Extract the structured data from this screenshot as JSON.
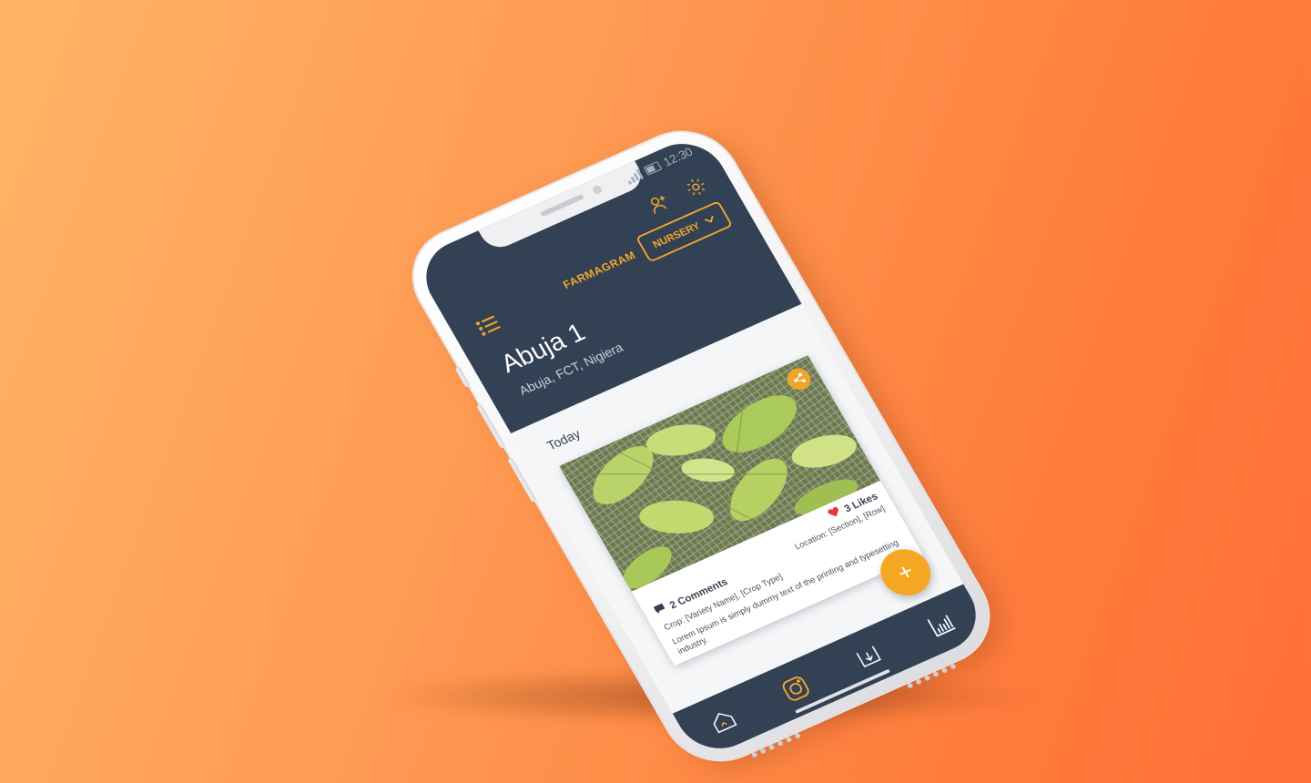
{
  "status_bar": {
    "time": "12:30"
  },
  "app": {
    "brand": "FARMAGRAM"
  },
  "header": {
    "dropdown_label": "NURSERY",
    "farm_title": "Abuja 1",
    "farm_subtitle": "Abuja, FCT, Nigiera"
  },
  "feed": {
    "section_label": "Today",
    "post": {
      "likes": "3 Likes",
      "comments": "2 Comments",
      "crop": "Crop:  [Variety Name], [Crop Type]",
      "location": "Location:  [Section], [Row]",
      "description": "Lorem Ipsum is simply dummy text of the printing and typesetting industry."
    }
  },
  "fab": {
    "label": "+"
  },
  "colors": {
    "header_bg": "#334155",
    "accent": "#f2a52c",
    "fab": "#f5a623",
    "like_heart": "#e53935"
  },
  "icons": {
    "menu": "menu-list-icon",
    "add_user": "add-user-icon",
    "settings": "gear-icon",
    "share": "share-icon",
    "heart": "heart-icon",
    "comment": "comment-icon",
    "nav": [
      "home-icon",
      "camera-icon",
      "download-icon",
      "bar-chart-icon"
    ]
  }
}
